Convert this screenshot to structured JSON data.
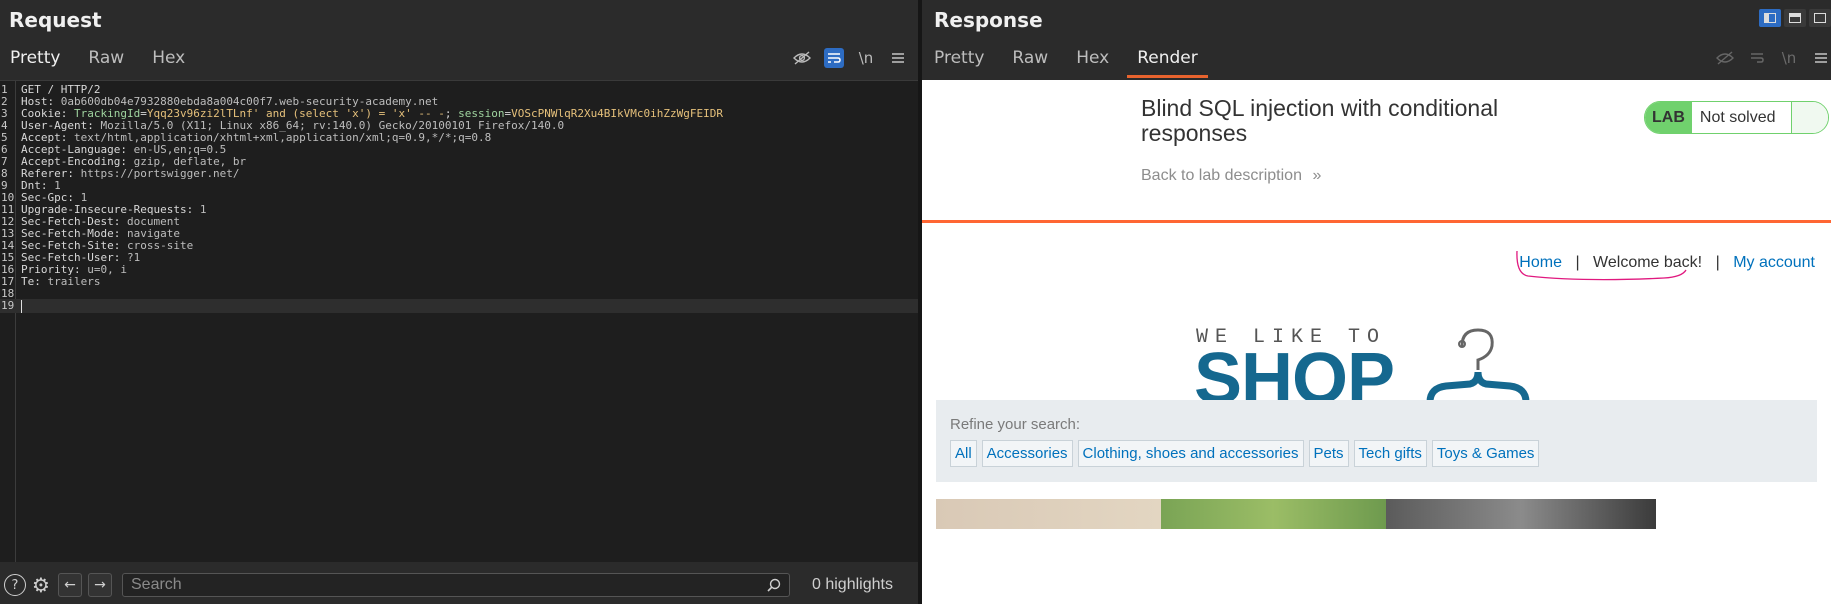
{
  "request": {
    "title": "Request",
    "tabs": [
      "Pretty",
      "Raw",
      "Hex"
    ],
    "active_tab": "Pretty",
    "toolbar_icons": [
      "hide-icon",
      "wrap-icon",
      "newline-icon",
      "menu-icon"
    ],
    "newline_label": "\\n",
    "lines": [
      {
        "n": "1",
        "key": "GET / HTTP/2",
        "val": ""
      },
      {
        "n": "2",
        "key": "Host: ",
        "val": "0ab600db04e7932880ebda8a004c00f7.web-security-academy.net"
      },
      {
        "n": "3",
        "key": "Cookie: ",
        "val": ""
      },
      {
        "n": "4",
        "key": "User-Agent: ",
        "val": "Mozilla/5.0 (X11; Linux x86_64; rv:140.0) Gecko/20100101 Firefox/140.0"
      },
      {
        "n": "5",
        "key": "Accept: ",
        "val": "text/html,application/xhtml+xml,application/xml;q=0.9,*/*;q=0.8"
      },
      {
        "n": "6",
        "key": "Accept-Language: ",
        "val": "en-US,en;q=0.5"
      },
      {
        "n": "7",
        "key": "Accept-Encoding: ",
        "val": "gzip, deflate, br"
      },
      {
        "n": "8",
        "key": "Referer: ",
        "val": "https://portswigger.net/"
      },
      {
        "n": "9",
        "key": "Dnt: ",
        "val": "1"
      },
      {
        "n": "10",
        "key": "Sec-Gpc: ",
        "val": "1"
      },
      {
        "n": "11",
        "key": "Upgrade-Insecure-Requests: ",
        "val": "1"
      },
      {
        "n": "12",
        "key": "Sec-Fetch-Dest: ",
        "val": "document"
      },
      {
        "n": "13",
        "key": "Sec-Fetch-Mode: ",
        "val": "navigate"
      },
      {
        "n": "14",
        "key": "Sec-Fetch-Site: ",
        "val": "cross-site"
      },
      {
        "n": "15",
        "key": "Sec-Fetch-User: ",
        "val": "?1"
      },
      {
        "n": "16",
        "key": "Priority: ",
        "val": "u=0, i"
      },
      {
        "n": "17",
        "key": "Te: ",
        "val": "trailers"
      },
      {
        "n": "18",
        "key": "",
        "val": ""
      },
      {
        "n": "19",
        "key": "",
        "val": ""
      }
    ],
    "cookie": {
      "name1": "TrackingId",
      "value1": "Yqq23v96zi2lTLnf' and (select 'x') = 'x' -- -",
      "sep": "; ",
      "name2": "session",
      "value2": "VOScPNWlqR2Xu4BIkVMc0ihZzWgFEIDR"
    },
    "search": {
      "placeholder": "Search"
    },
    "highlights": "0 highlights"
  },
  "response": {
    "title": "Response",
    "tabs": [
      "Pretty",
      "Raw",
      "Hex",
      "Render"
    ],
    "active_tab": "Render",
    "render": {
      "lab_title": "Blind SQL injection with conditional responses",
      "back_link": "Back to lab description",
      "back_chevron": "»",
      "lab_badge": "LAB",
      "lab_status": "Not solved",
      "nav": {
        "home": "Home",
        "sep": "|",
        "welcome": "Welcome back!",
        "account": "My account"
      },
      "logo": {
        "tagline": "WE LIKE TO",
        "word": "SHOP"
      },
      "refine_label": "Refine your search:",
      "filters": [
        "All",
        "Accessories",
        "Clothing, shoes and accessories",
        "Pets",
        "Tech gifts",
        "Toys & Games"
      ]
    }
  },
  "colors": {
    "accent_blue": "#2d6cc3",
    "active_tab_underline": "#e8632e",
    "lab_green": "#70d16d",
    "link_blue": "#0071bc",
    "header_orange": "#ff6633",
    "scribble": "#e0197f"
  }
}
